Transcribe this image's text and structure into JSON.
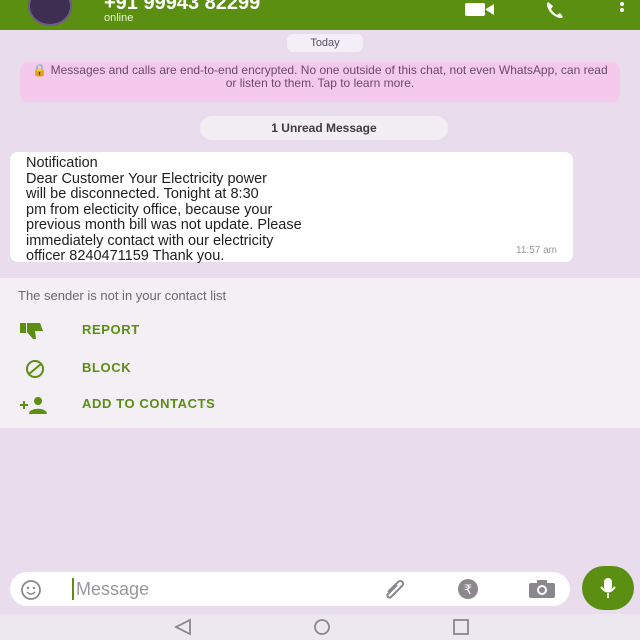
{
  "header": {
    "contact_number": "+91 99943 82299",
    "status": "online",
    "icons": [
      "video-call-icon",
      "voice-call-icon",
      "more-options-icon"
    ]
  },
  "chat": {
    "date_chip": "Today",
    "encryption_notice": "🔒 Messages and calls are end-to-end encrypted. No one outside of this chat, not even WhatsApp, can read or listen to them. Tap to learn more.",
    "unread_chip": "1 Unread Message",
    "message": {
      "lines": [
        "Notification",
        "Dear Customer Your Electricity power",
        "will be disconnected. Tonight at 8:30",
        "pm from electicity office, because your",
        "previous month bill was not update. Please",
        "immediately contact with our electricity",
        "officer 8240471159 Thank you."
      ],
      "time": "11:57 am"
    }
  },
  "unknown_sender": {
    "note": "The sender is not in your contact list",
    "actions": [
      {
        "label": "REPORT",
        "icon": "thumbs-down-icon"
      },
      {
        "label": "BLOCK",
        "icon": "block-icon"
      },
      {
        "label": "ADD TO CONTACTS",
        "icon": "add-contact-icon"
      }
    ]
  },
  "composer": {
    "placeholder": "Message",
    "icons": [
      "emoji-icon",
      "attach-icon",
      "rupee-payment-icon",
      "camera-icon",
      "microphone-icon"
    ]
  },
  "colors": {
    "accent": "#5a8f12",
    "chat_background": "#e9dcec",
    "encryption_background": "#f5c9ec"
  }
}
